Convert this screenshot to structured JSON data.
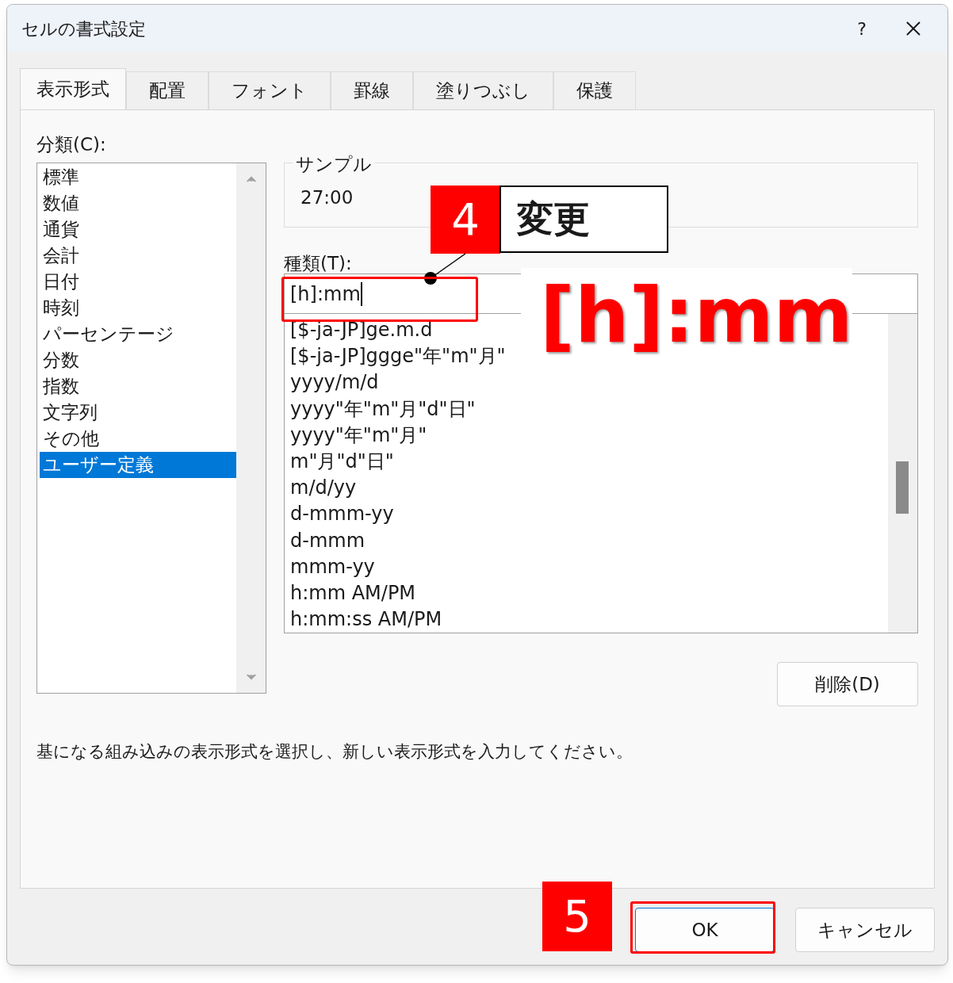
{
  "window": {
    "title": "セルの書式設定",
    "help": "?"
  },
  "tabs": [
    {
      "label": "表示形式",
      "selected": true
    },
    {
      "label": "配置",
      "selected": false
    },
    {
      "label": "フォント",
      "selected": false
    },
    {
      "label": "罫線",
      "selected": false
    },
    {
      "label": "塗りつぶし",
      "selected": false
    },
    {
      "label": "保護",
      "selected": false
    }
  ],
  "category": {
    "label": "分類(C):",
    "items": [
      {
        "label": "標準",
        "selected": false
      },
      {
        "label": "数値",
        "selected": false
      },
      {
        "label": "通貨",
        "selected": false
      },
      {
        "label": "会計",
        "selected": false
      },
      {
        "label": "日付",
        "selected": false
      },
      {
        "label": "時刻",
        "selected": false
      },
      {
        "label": "パーセンテージ",
        "selected": false
      },
      {
        "label": "分数",
        "selected": false
      },
      {
        "label": "指数",
        "selected": false
      },
      {
        "label": "文字列",
        "selected": false
      },
      {
        "label": "その他",
        "selected": false
      },
      {
        "label": "ユーザー定義",
        "selected": true
      }
    ]
  },
  "sample": {
    "legend": "サンプル",
    "value": "27:00"
  },
  "type": {
    "label": "種類(T):",
    "value": "[h]:mm",
    "options": [
      "[$-ja-JP]ge.m.d",
      "[$-ja-JP]ggge\"年\"m\"月\"",
      "yyyy/m/d",
      "yyyy\"年\"m\"月\"d\"日\"",
      "yyyy\"年\"m\"月\"",
      "m\"月\"d\"日\"",
      "m/d/yy",
      "d-mmm-yy",
      "d-mmm",
      "mmm-yy",
      "h:mm AM/PM",
      "h:mm:ss AM/PM"
    ]
  },
  "delete_button": "削除(D)",
  "description": "基になる組み込みの表示形式を選択し、新しい表示形式を入力してください。",
  "buttons": [
    "OK",
    "キャンセル"
  ],
  "annotations": {
    "step_4": {
      "number": "4",
      "text": "変更"
    },
    "overlay_text": "[h]:mm",
    "step_5": {
      "number": "5"
    }
  }
}
